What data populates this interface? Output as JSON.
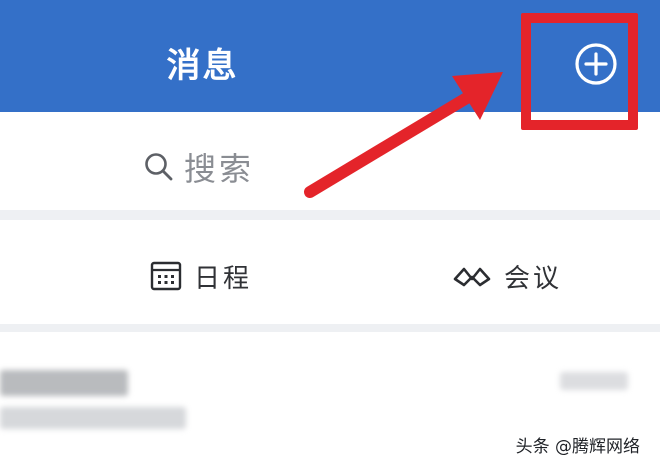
{
  "header": {
    "title": "消息",
    "add_icon": "plus-circle-icon",
    "background_color": "#3470c8"
  },
  "search": {
    "placeholder": "搜索",
    "icon": "search-icon"
  },
  "quick_actions": [
    {
      "label": "日程",
      "icon": "calendar-icon"
    },
    {
      "label": "会议",
      "icon": "meeting-icon"
    }
  ],
  "annotation": {
    "highlight_color": "#e4242a"
  },
  "watermark": "头条 @腾辉网络"
}
